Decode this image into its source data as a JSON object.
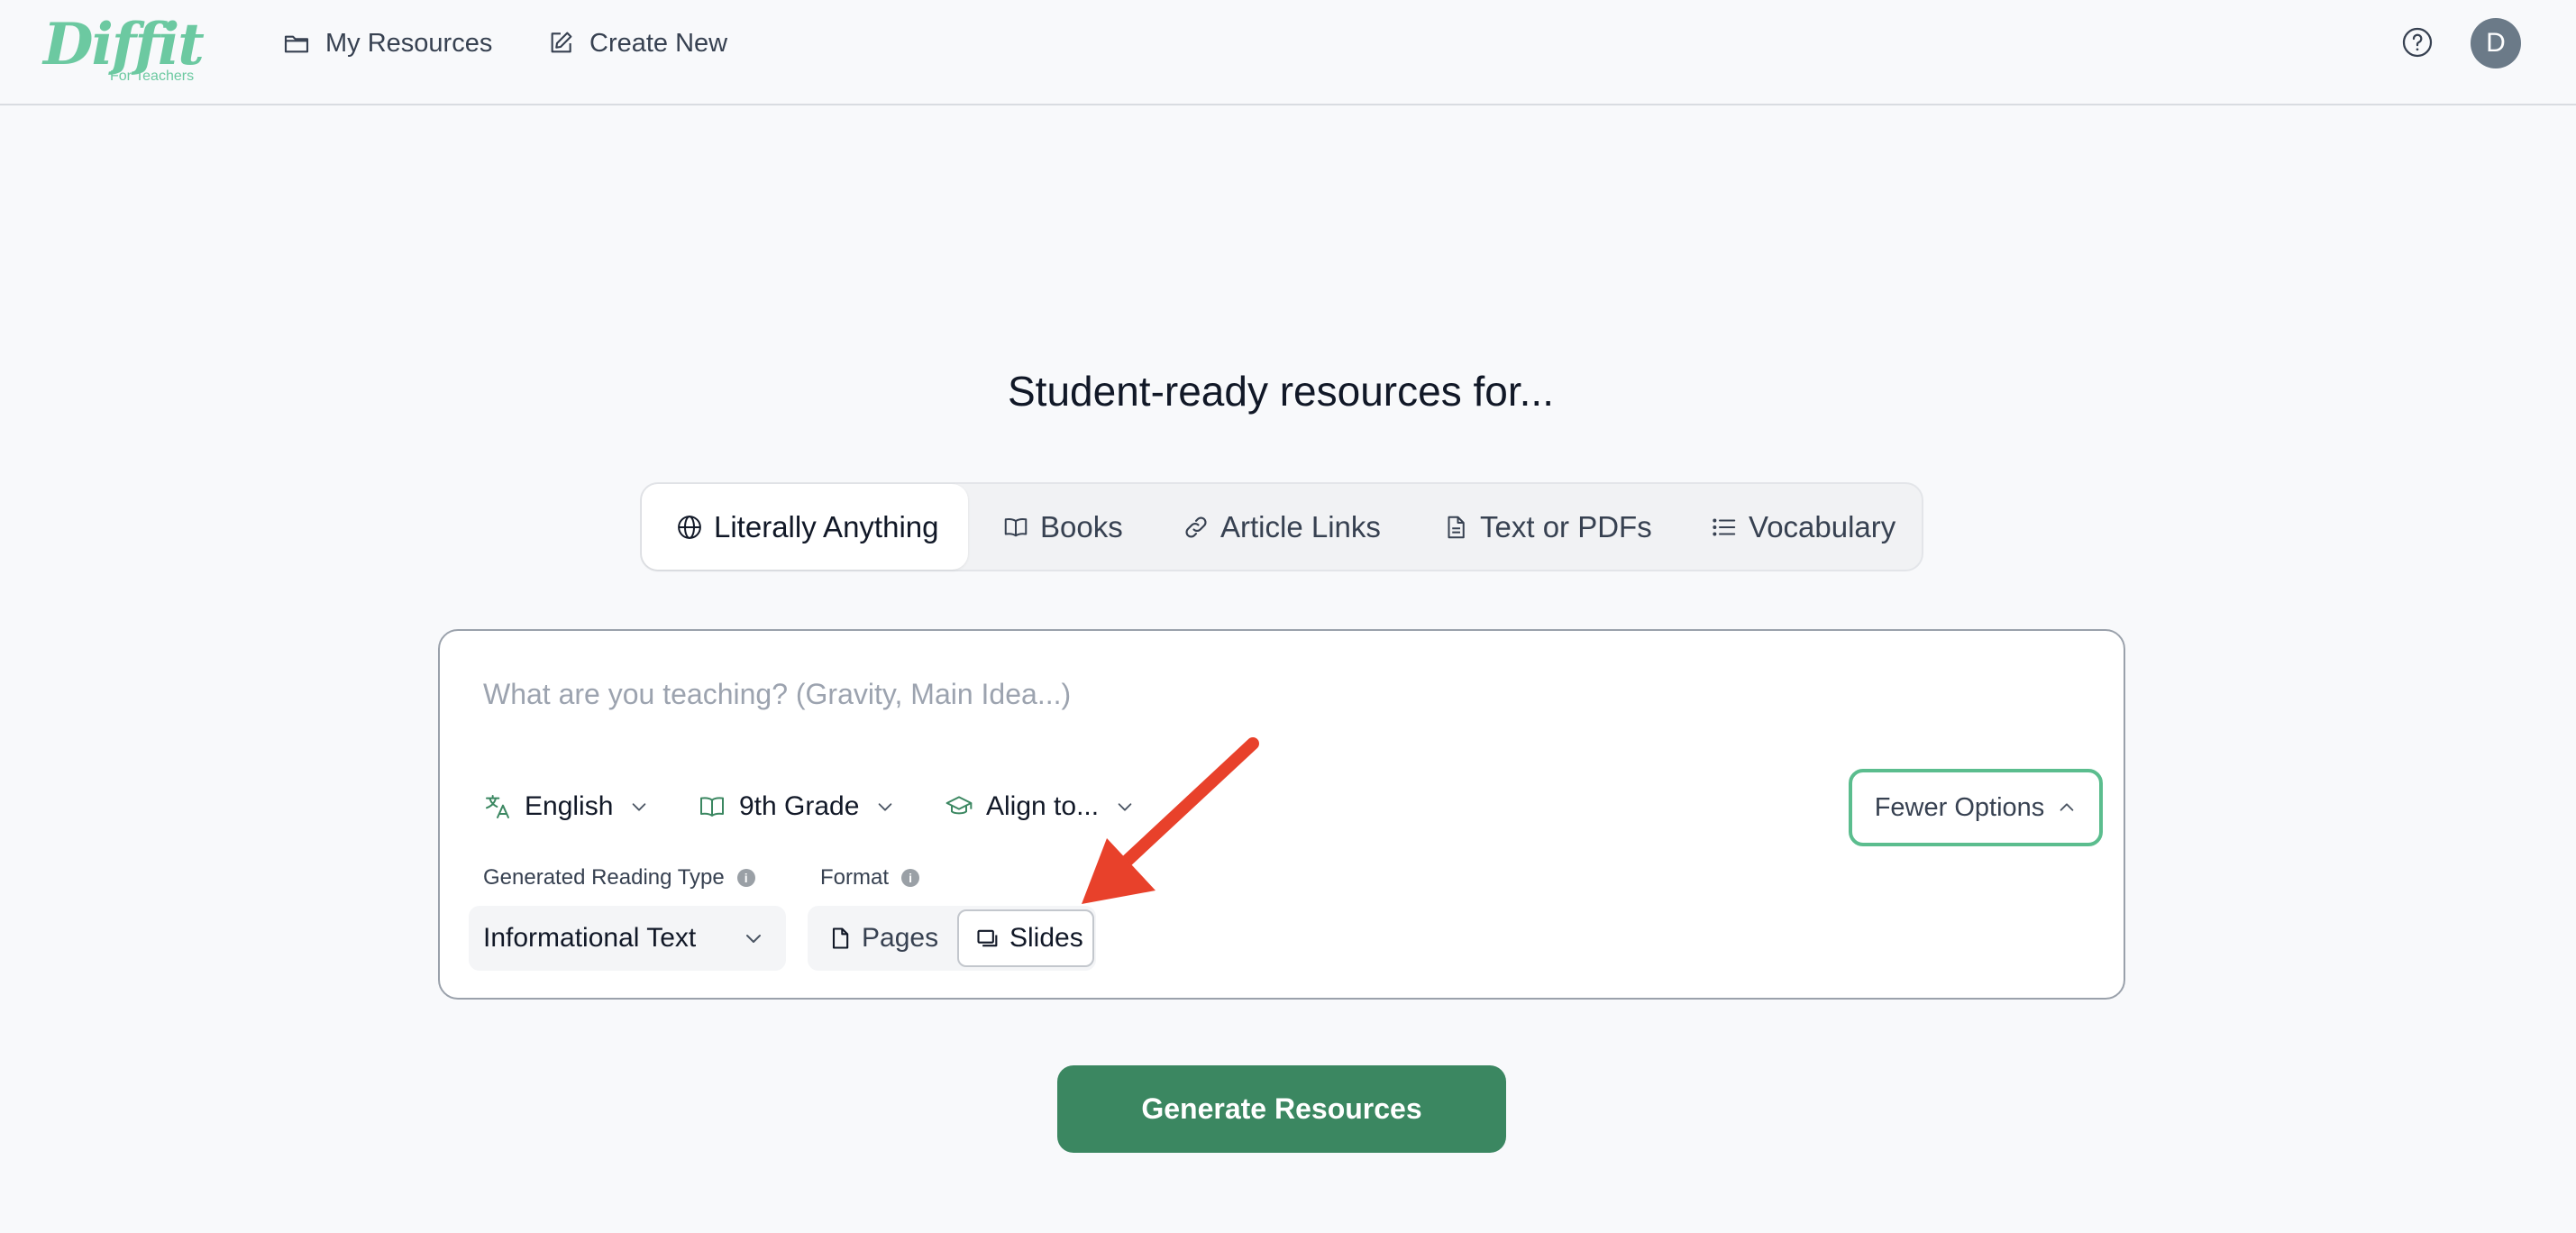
{
  "brand": {
    "logo_text": "Diffit",
    "logo_sub": "For Teachers",
    "color": "#6cc9a1"
  },
  "nav": {
    "my_resources": "My Resources",
    "create_new": "Create New",
    "avatar_initial": "D"
  },
  "hero": {
    "title": "Student-ready resources for..."
  },
  "source_tabs": [
    {
      "label": "Literally Anything",
      "icon": "globe-icon",
      "active": true
    },
    {
      "label": "Books",
      "icon": "book-icon",
      "active": false
    },
    {
      "label": "Article Links",
      "icon": "link-icon",
      "active": false
    },
    {
      "label": "Text or PDFs",
      "icon": "document-icon",
      "active": false
    },
    {
      "label": "Vocabulary",
      "icon": "list-icon",
      "active": false
    }
  ],
  "form": {
    "topic_placeholder": "What are you teaching? (Gravity, Main Idea...)",
    "topic_value": "",
    "language": "English",
    "grade": "9th Grade",
    "align": "Align to...",
    "fewer_options": "Fewer Options",
    "reading_type_label": "Generated Reading Type",
    "reading_type_value": "Informational Text",
    "format_label": "Format",
    "format_options": [
      "Pages",
      "Slides"
    ],
    "format_selected": "Slides"
  },
  "actions": {
    "generate": "Generate Resources"
  },
  "colors": {
    "accent": "#3b8761",
    "accent_light": "#5bbd8e",
    "annotation_arrow": "#e8412b"
  }
}
